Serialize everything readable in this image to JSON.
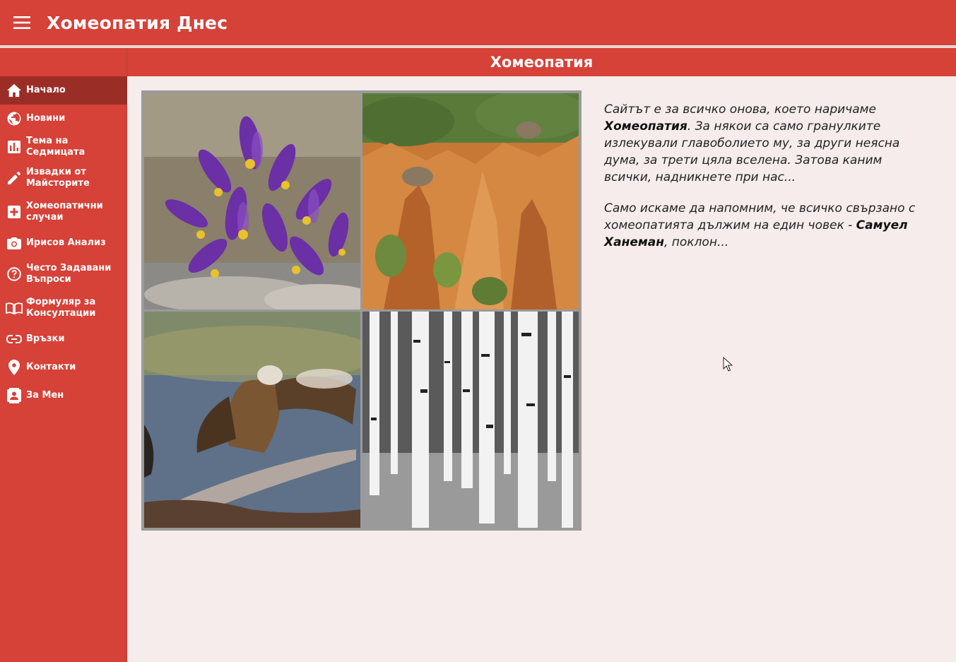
{
  "app": {
    "title": "Хомеопатия Днес"
  },
  "section": {
    "title": "Хомеопатия"
  },
  "sidebar": {
    "items": [
      {
        "label": "Начало",
        "icon": "home-icon"
      },
      {
        "label": "Новини",
        "icon": "globe-icon"
      },
      {
        "label": "Тема на Седмицата",
        "icon": "bar-chart-icon"
      },
      {
        "label": "Извадки от Майсторите",
        "icon": "pencil-icon"
      },
      {
        "label": "Хомеопатични случаи",
        "icon": "medical-plus-icon"
      },
      {
        "label": "Ирисов Анализ",
        "icon": "camera-icon"
      },
      {
        "label": "Често Задавани Въпроси",
        "icon": "help-icon"
      },
      {
        "label": "Формуляр за Консултации",
        "icon": "book-icon"
      },
      {
        "label": "Връзки",
        "icon": "link-icon"
      },
      {
        "label": "Контакти",
        "icon": "location-pin-icon"
      },
      {
        "label": "За Мен",
        "icon": "contact-card-icon"
      }
    ]
  },
  "intro": {
    "p1_a": "Сайтът е за всичко онова, което наричаме ",
    "p1_b": "Хомеопатия",
    "p1_c": ". За някои са само гранулките излекували главоболието му, за други неясна дума, за трети цяла вселена. Затова каним всички, надникнете при нас...",
    "p2_a": "Само искаме да напомним, че всичко свързано с хомеопатията дължим на един човек - ",
    "p2_b": "Самуел Ханеман",
    "p2_c": ", поклон..."
  },
  "theme": {
    "primary": "#d64138",
    "active": "#9b2d27",
    "background": "#f6ecec"
  }
}
